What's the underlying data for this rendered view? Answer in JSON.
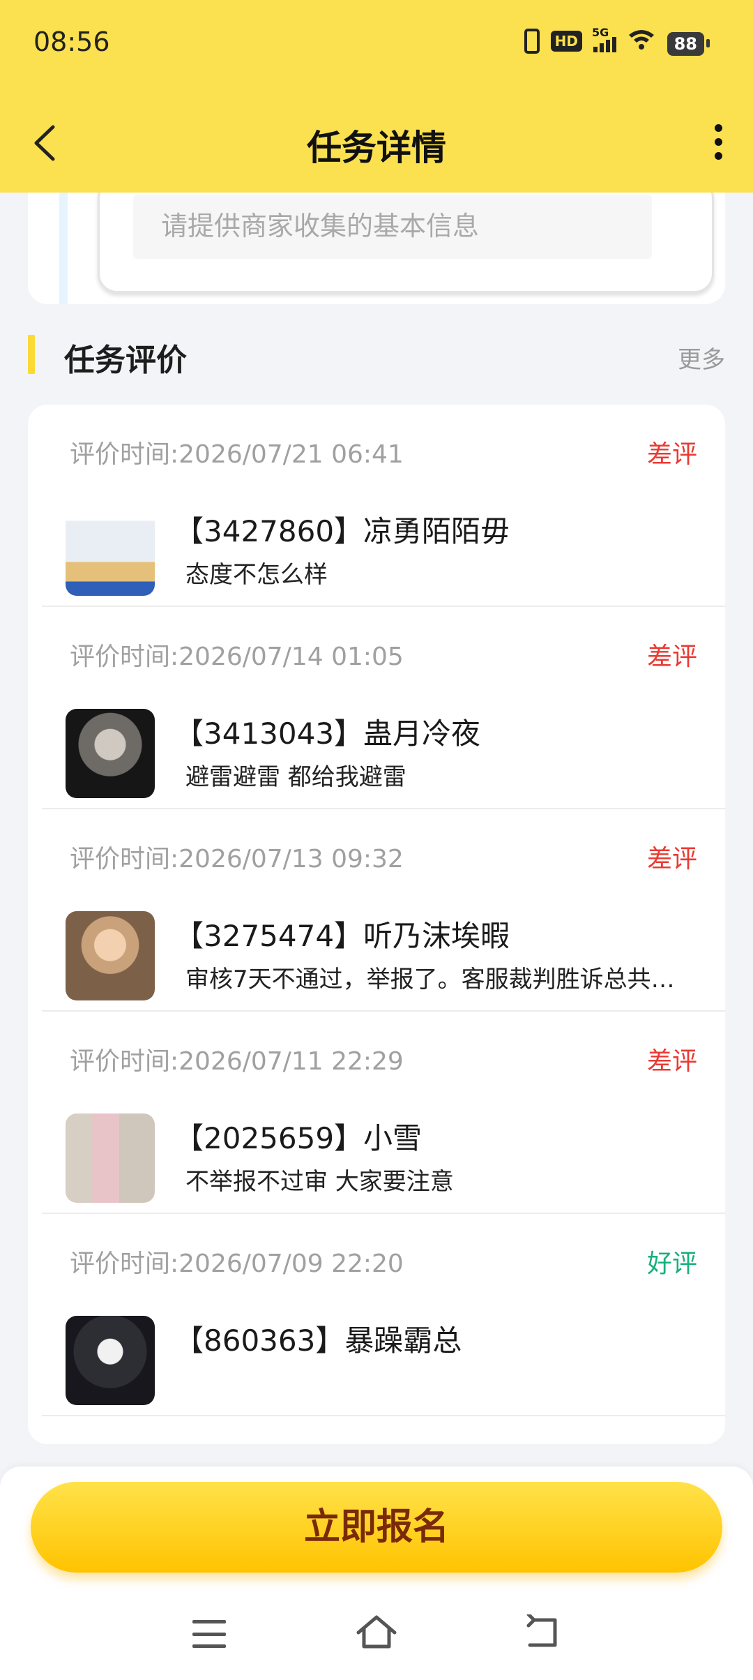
{
  "status_bar": {
    "time": "08:56",
    "network": "HD",
    "signal_type": "5G",
    "battery": "88"
  },
  "header": {
    "title": "任务详情",
    "background_color": "#fbe04f"
  },
  "previous_section": {
    "input_placeholder": "请提供商家收集的基本信息"
  },
  "reviews_section": {
    "title": "任务评价",
    "more_label": "更多",
    "items": [
      {
        "time_label": "评价时间:2026/07/21 06:41",
        "rating": "差评",
        "name": "【3427860】凉勇陌陌毋",
        "comment": "态度不怎么样"
      },
      {
        "time_label": "评价时间:2026/07/14 01:05",
        "rating": "差评",
        "name": "【3413043】蛊月冷夜",
        "comment": "避雷避雷 都给我避雷"
      },
      {
        "time_label": "评价时间:2026/07/13 09:32",
        "rating": "差评",
        "name": "【3275474】听乃沫埃暇",
        "comment": "审核7天不通过，举报了。客服裁判胜诉总共…"
      },
      {
        "time_label": "评价时间:2026/07/11 22:29",
        "rating": "差评",
        "name": "【2025659】小雪",
        "comment": "不举报不过审  大家要注意"
      },
      {
        "time_label": "评价时间:2026/07/09 22:20",
        "rating": "好评",
        "name": "【860363】暴躁霸总",
        "comment": ""
      }
    ]
  },
  "footer": {
    "signup_label": "立即报名"
  },
  "colors": {
    "bad_rating": "#ea3a32",
    "good_rating": "#17b07c",
    "accent": "#ffc300"
  }
}
